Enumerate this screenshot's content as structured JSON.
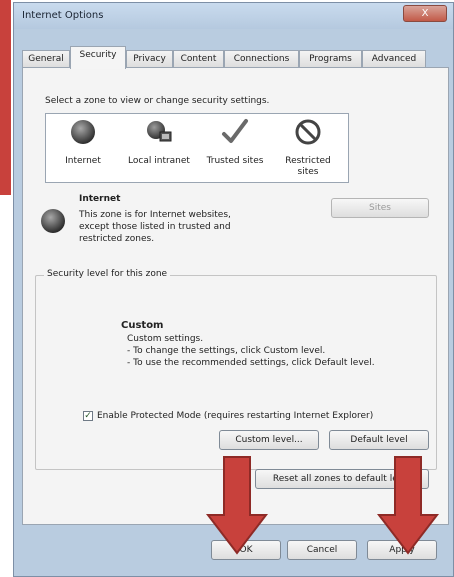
{
  "window": {
    "title": "Internet Options",
    "close_glyph": "X"
  },
  "tabs": [
    {
      "label": "General"
    },
    {
      "label": "Security"
    },
    {
      "label": "Privacy"
    },
    {
      "label": "Content"
    },
    {
      "label": "Connections"
    },
    {
      "label": "Programs"
    },
    {
      "label": "Advanced"
    }
  ],
  "active_tab": "Security",
  "zones": {
    "instruction": "Select a zone to view or change security settings.",
    "items": [
      {
        "label": "Internet",
        "icon": "globe-icon"
      },
      {
        "label": "Local intranet",
        "icon": "intranet-icon"
      },
      {
        "label": "Trusted sites",
        "icon": "checkmark-icon"
      },
      {
        "label": "Restricted sites",
        "icon": "restricted-icon"
      }
    ]
  },
  "selected_zone": {
    "name": "Internet",
    "description": "This zone is for Internet websites, except those listed in trusted and restricted zones.",
    "sites_button": "Sites"
  },
  "security_level": {
    "group_label": "Security level for this zone",
    "level_name": "Custom",
    "line1": "Custom settings.",
    "line2": "- To change the settings, click Custom level.",
    "line3": "- To use the recommended settings, click Default level.",
    "protected_mode_label": "Enable Protected Mode (requires restarting Internet Explorer)",
    "protected_mode_checked": true,
    "custom_level_button": "Custom level...",
    "default_level_button": "Default level"
  },
  "reset_button": "Reset all zones to default level",
  "footer": {
    "ok": "OK",
    "cancel": "Cancel",
    "apply": "Apply"
  },
  "colors": {
    "arrow": "#c8413c",
    "window_frame": "#b9cce0"
  }
}
